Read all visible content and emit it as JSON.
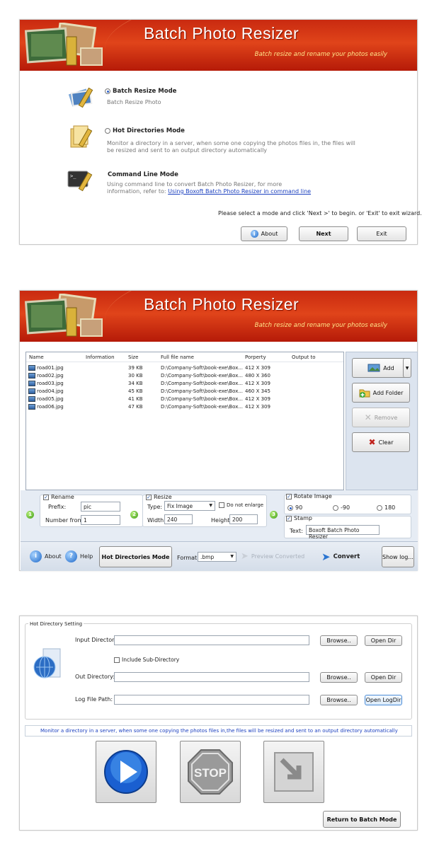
{
  "app": {
    "title": "Batch Photo Resizer",
    "subtitle": "Batch resize and rename your photos easily"
  },
  "wizard": {
    "modes": [
      {
        "label": "Batch Resize Mode",
        "desc": "Batch Resize Photo",
        "selected": true
      },
      {
        "label": "Hot Directories Mode",
        "desc1": "Monitor a directory in a server, when some one copying the photos files in, the files will",
        "desc2": "be resized and sent to an output directory automatically",
        "selected": false
      },
      {
        "label": "Command Line Mode",
        "desc1": "Using command line to convert Batch Photo Resizer, for more",
        "desc2_prefix": "information, refer to:",
        "link": "Using Boxoft Batch Photo Resizer in command line"
      }
    ],
    "instruction": "Please select a mode and click 'Next >' to begin. or 'Exit' to exit wizard.",
    "about_label": "About",
    "next_label": "Next",
    "exit_label": "Exit"
  },
  "batch": {
    "columns": [
      "Name",
      "Information",
      "Size",
      "Full file name",
      "Porperty",
      "Output to"
    ],
    "files": [
      {
        "name": "road01.jpg",
        "size": "39 KB",
        "path": "D:\\Company-Soft\\book-exe\\Box...",
        "prop": "412 X 309"
      },
      {
        "name": "road02.jpg",
        "size": "30 KB",
        "path": "D:\\Company-Soft\\book-exe\\Box...",
        "prop": "480 X 360"
      },
      {
        "name": "road03.jpg",
        "size": "34 KB",
        "path": "D:\\Company-Soft\\book-exe\\Box...",
        "prop": "412 X 309"
      },
      {
        "name": "road04.jpg",
        "size": "45 KB",
        "path": "D:\\Company-Soft\\book-exe\\Box...",
        "prop": "460 X 345"
      },
      {
        "name": "road05.jpg",
        "size": "41 KB",
        "path": "D:\\Company-Soft\\book-exe\\Box...",
        "prop": "412 X 309"
      },
      {
        "name": "road06.jpg",
        "size": "47 KB",
        "path": "D:\\Company-Soft\\book-exe\\Box...",
        "prop": "412 X 309"
      }
    ],
    "add_label": "Add",
    "add_folder_label": "Add Folder",
    "remove_label": "Remove",
    "clear_label": "Clear",
    "rename": {
      "label": "Rename",
      "prefix_label": "Prefix:",
      "prefix_value": "pic",
      "number_label": "Number from:",
      "number_value": "1"
    },
    "resize": {
      "label": "Resize",
      "type_label": "Type:",
      "type_value": "Fix Image",
      "no_enlarge": "Do not enlarge",
      "width_label": "Width:",
      "width_value": "240",
      "height_label": "Height:",
      "height_value": "200"
    },
    "rotate": {
      "label": "Rotate Image",
      "options": [
        "90",
        "-90",
        "180"
      ]
    },
    "stamp": {
      "label": "Stamp",
      "text_label": "Text:",
      "text_value": "Boxoft Batch Photo Resizer"
    },
    "about_label": "About",
    "help_label": "Help",
    "hot_dir_label": "Hot Directories Mode",
    "format_label": "Format:",
    "format_value": ".bmp",
    "preview_label": "Preview Converted",
    "convert_label": "Convert",
    "showlog_label": "Show log..."
  },
  "hot": {
    "group_label": "Hot Directory Setting",
    "input_label": "Input Directory:",
    "include_sub": "Include Sub-Directory",
    "out_label": "Out Directory:",
    "log_label": "Log File Path:",
    "browse_label": "Browse..",
    "open_dir_label": "Open Dir",
    "open_logdir_label": "Open LogDir",
    "info": "Monitor a directory in a server, when some one copying the photos files in,the files will be resized and sent to an output directory automatically",
    "stop_label": "STOP",
    "return_label": "Return to Batch Mode"
  },
  "colors": {
    "banner": "#c92a10",
    "subtitle": "#ffe58a",
    "link": "#1a3fbf",
    "info_text": "#1a3fbf"
  }
}
